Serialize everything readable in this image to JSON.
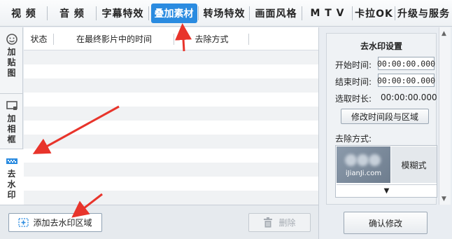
{
  "top_tabs": [
    {
      "label": "视 频"
    },
    {
      "label": "音 频"
    },
    {
      "label": "字幕特效"
    },
    {
      "label": "叠加素材"
    },
    {
      "label": "转场特效"
    },
    {
      "label": "画面风格"
    },
    {
      "label": "M T V"
    },
    {
      "label": "卡拉OK"
    },
    {
      "label": "升级与服务"
    }
  ],
  "active_tab": "叠加素材",
  "side_tabs": [
    {
      "label": "加贴图",
      "icon": "sticker-icon"
    },
    {
      "label": "加相框",
      "icon": "frame-icon"
    },
    {
      "label": "去水印",
      "icon": "watermark-icon"
    }
  ],
  "table": {
    "columns": [
      "状态",
      "在最终影片中的时间",
      "去除方式"
    ]
  },
  "bottom": {
    "add_label": "添加去水印区域",
    "delete_label": "删除"
  },
  "settings": {
    "title": "去水印设置",
    "start_label": "开始时间:",
    "start_value": "00:00:00.000",
    "end_label": "结束时间:",
    "end_value": "00:00:00.000",
    "duration_label": "选取时长:",
    "duration_value": "00:00:00.000",
    "modify_label": "修改时间段与区域",
    "method_label": "去除方式:",
    "method_value": "模糊式",
    "thumb_watermark": "iJianJi.com",
    "confirm_label": "确认修改"
  },
  "colors": {
    "accent": "#2a8be0",
    "annotation_arrow": "#e8342b"
  }
}
